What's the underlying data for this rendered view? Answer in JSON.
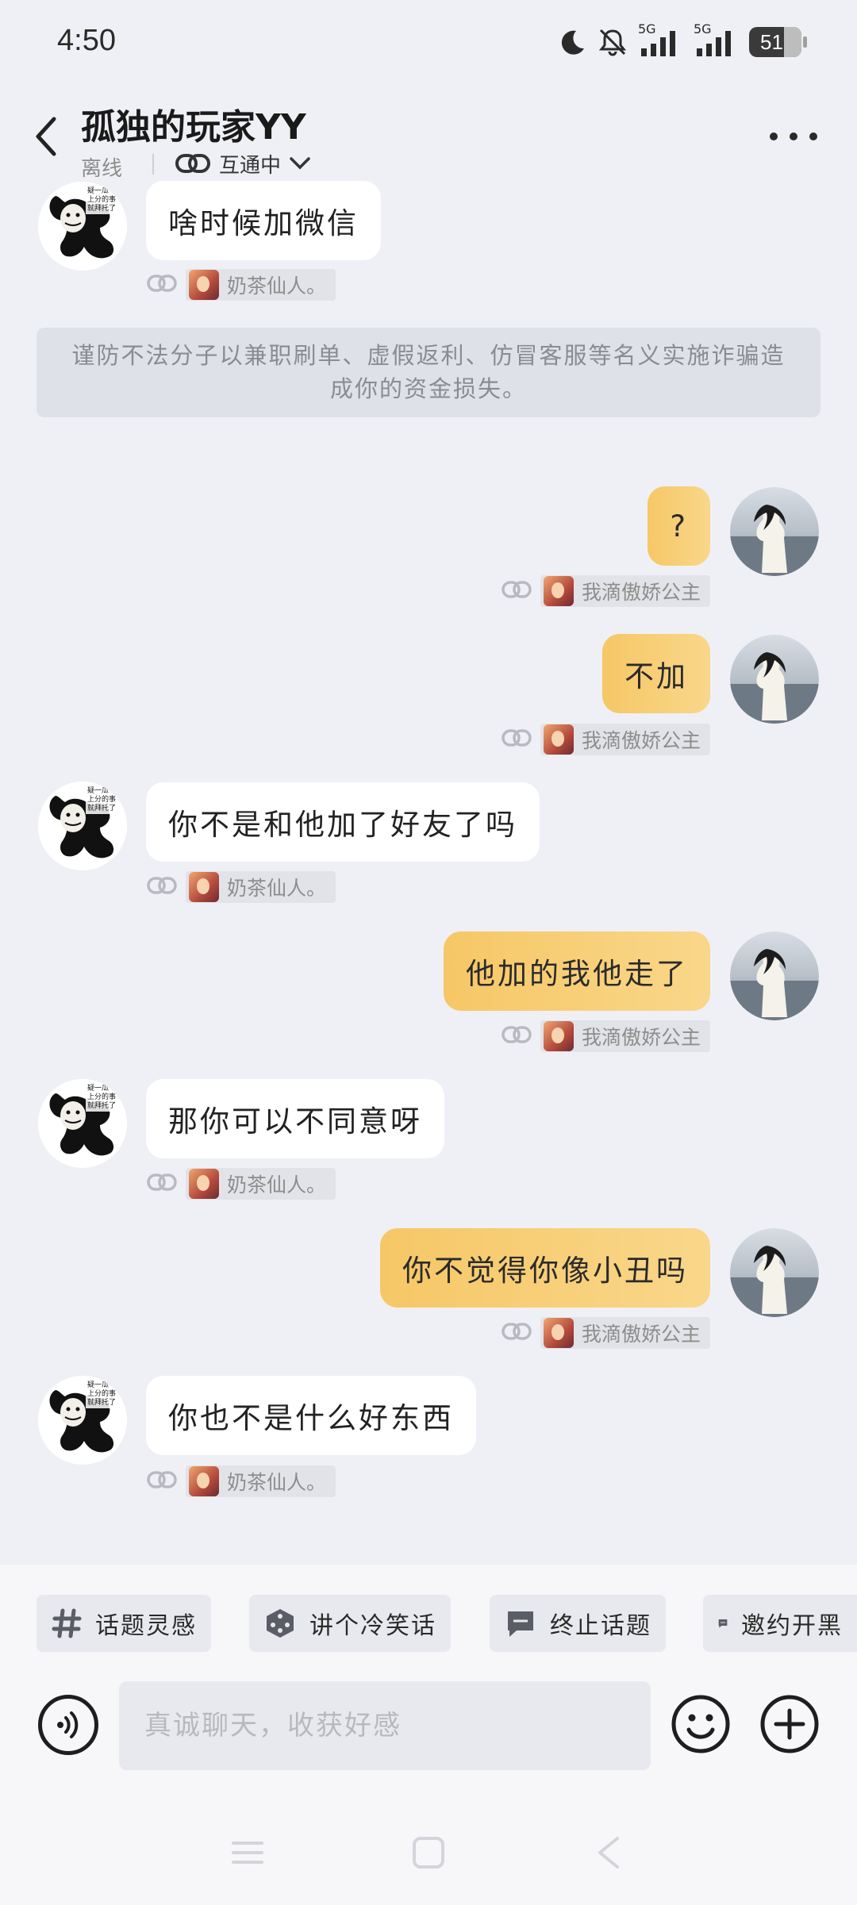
{
  "status_bar": {
    "time": "4:50",
    "signal_1": "5G",
    "signal_2": "5G",
    "battery": "51"
  },
  "header": {
    "contact_name": "孤独的玩家YY",
    "presence": "离线",
    "link_state": "互通中"
  },
  "warning_text": "谨防不法分子以兼职刷单、虚假返利、仿冒客服等名义实施诈骗造成你的资金损失。",
  "messages": [
    {
      "side": "left",
      "text": "啥时候加微信",
      "tag": "奶茶仙人。"
    },
    {
      "side": "right",
      "text": "?",
      "tag": "我滴傲娇公主"
    },
    {
      "side": "right",
      "text": "不加",
      "tag": "我滴傲娇公主"
    },
    {
      "side": "left",
      "text": "你不是和他加了好友了吗",
      "tag": "奶茶仙人。"
    },
    {
      "side": "right",
      "text": "他加的我他走了",
      "tag": "我滴傲娇公主"
    },
    {
      "side": "left",
      "text": "那你可以不同意呀",
      "tag": "奶茶仙人。"
    },
    {
      "side": "right",
      "text": "你不觉得你像小丑吗",
      "tag": "我滴傲娇公主"
    },
    {
      "side": "left",
      "text": "你也不是什么好东西",
      "tag": "奶茶仙人。"
    }
  ],
  "avatar_caption": [
    "疑一瓜",
    "上分的事",
    "就拜托了"
  ],
  "quick_actions": [
    "话题灵感",
    "讲个冷笑话",
    "终止话题",
    "邀约开黑"
  ],
  "input": {
    "placeholder": "真诚聊天，收获好感"
  },
  "icons": {
    "back": "chevron-left-icon",
    "more": "more-dots-icon",
    "link": "link-icon",
    "voice": "voice-icon",
    "emoji": "smiley-icon",
    "plus": "plus-icon"
  },
  "colors": {
    "background": "#eff0f5",
    "bubble_mine": "#f7cb6f",
    "bubble_theirs": "#ffffff"
  }
}
